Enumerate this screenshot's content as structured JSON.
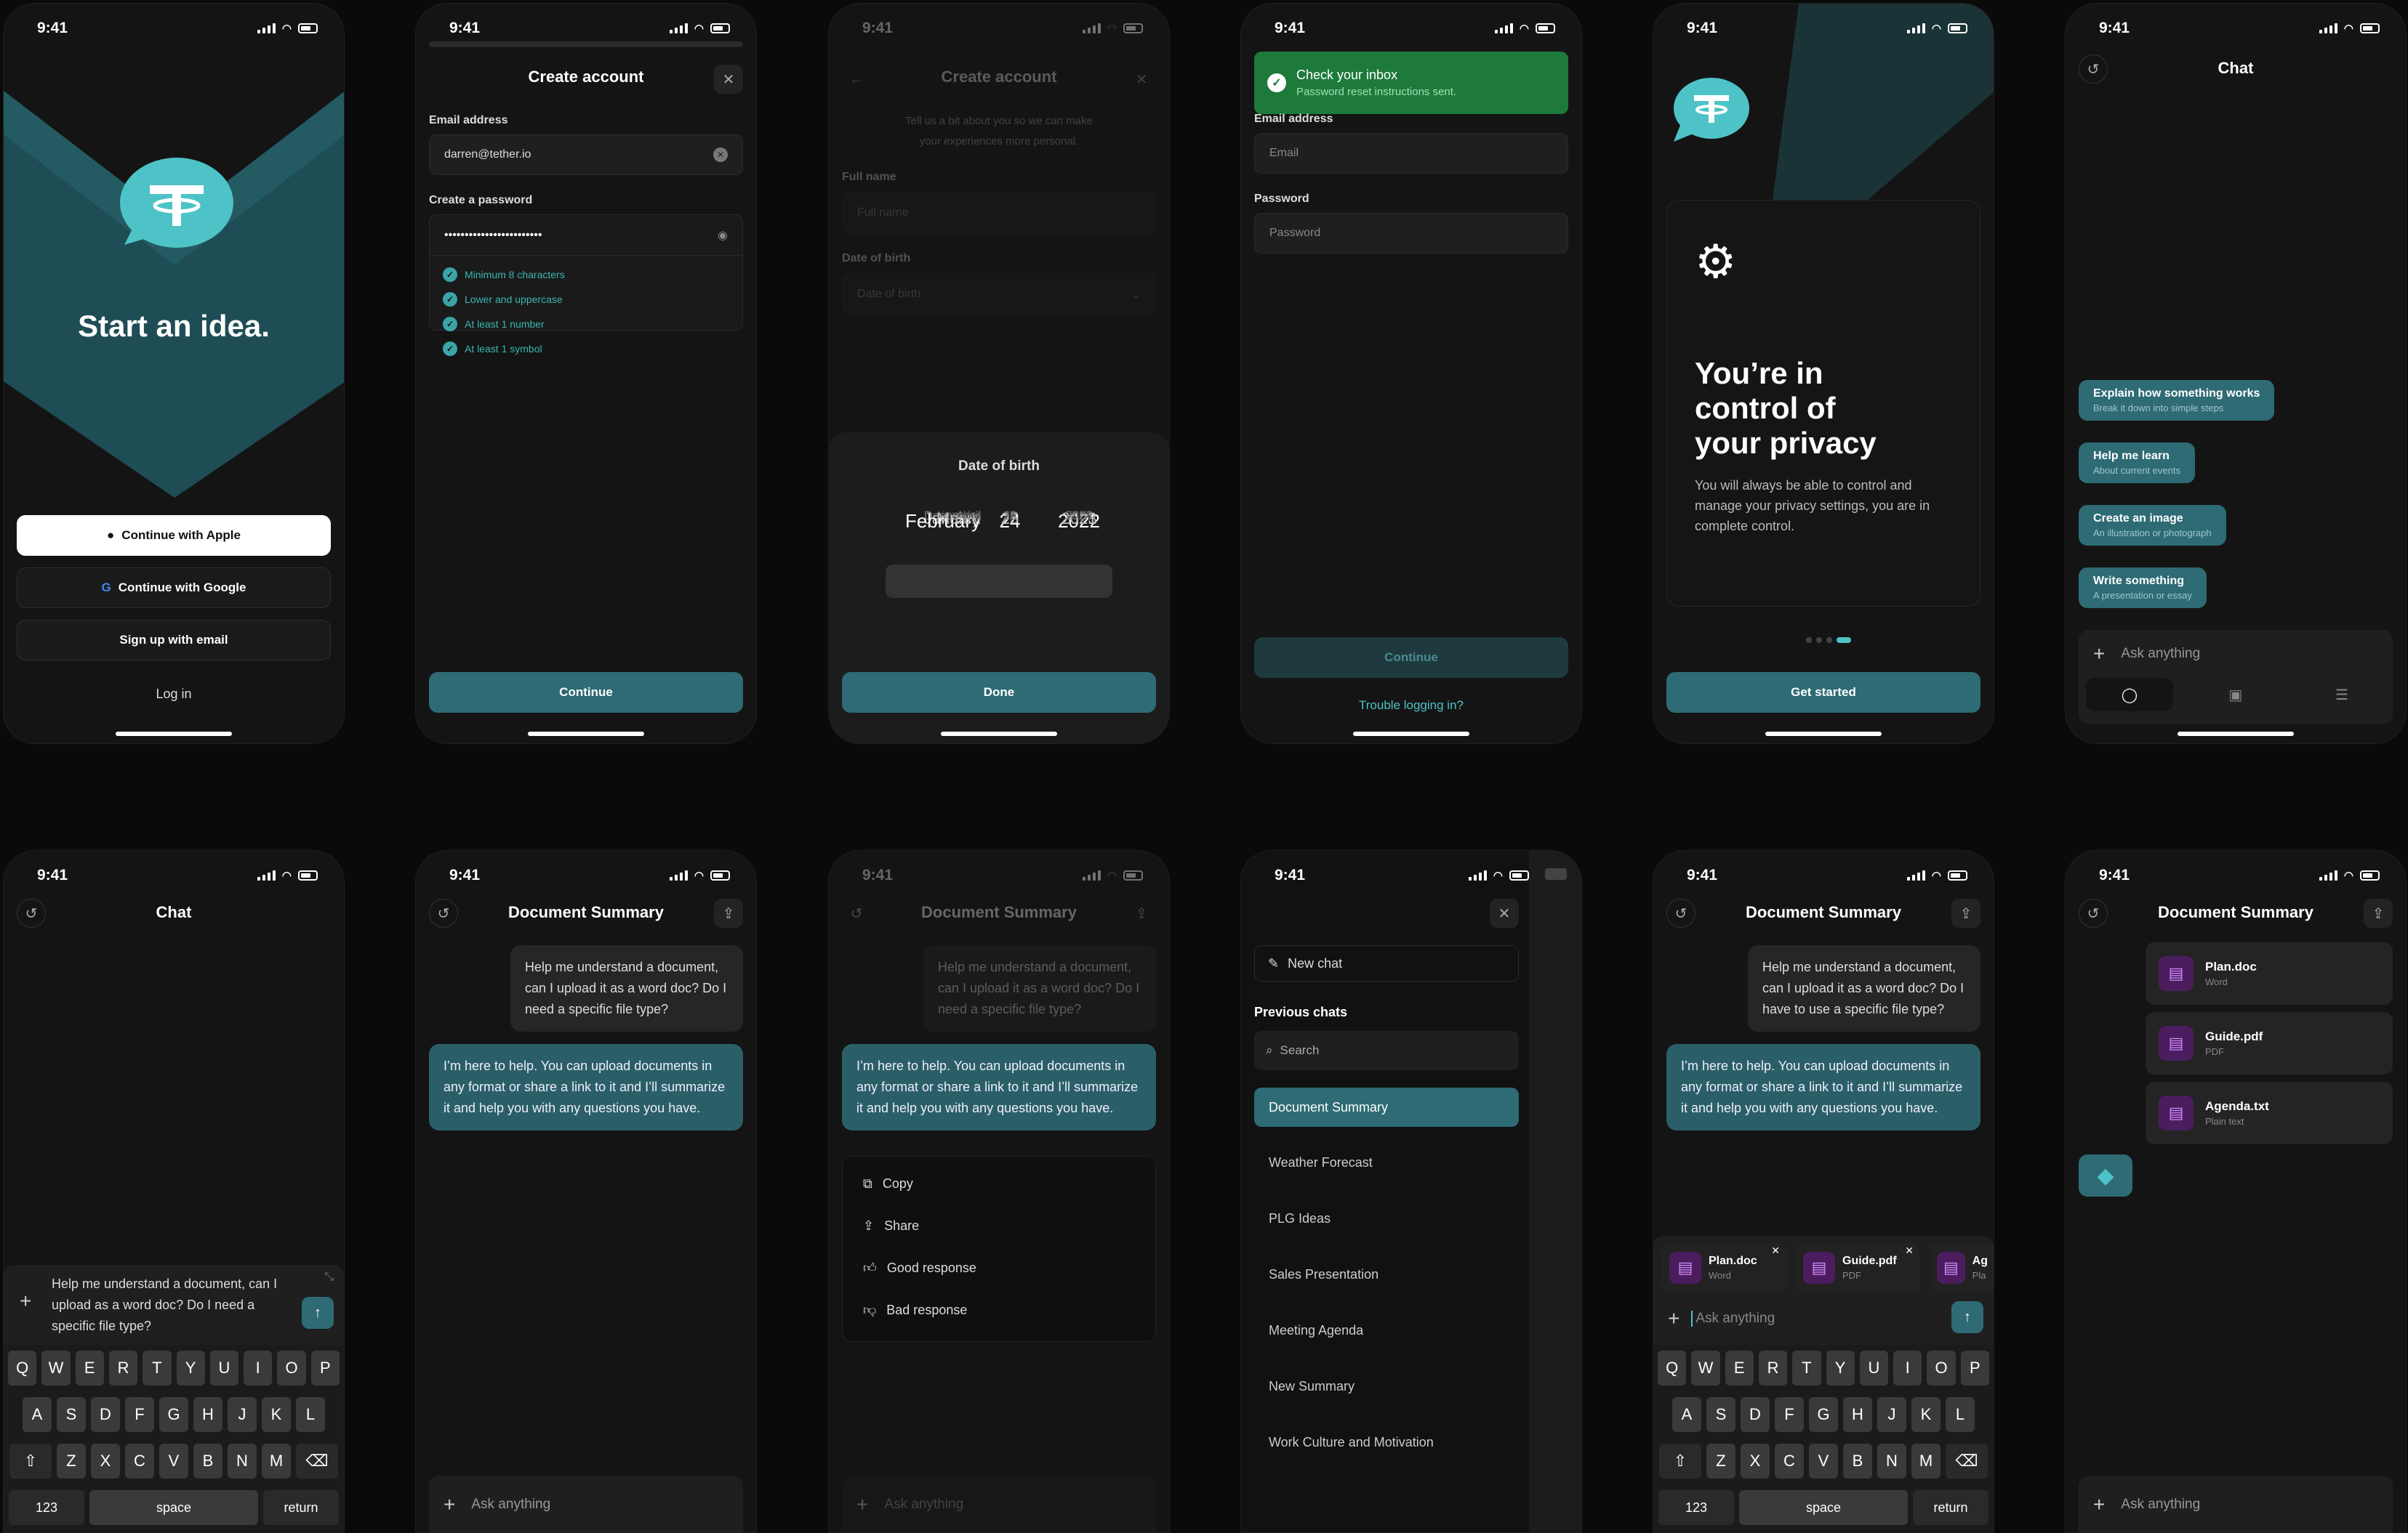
{
  "status_time": "9:41",
  "s1": {
    "headline": "Start an idea.",
    "apple": "Continue with Apple",
    "google": "Continue with Google",
    "email": "Sign up with email",
    "login": "Log in"
  },
  "s2": {
    "title": "Create account",
    "email_label": "Email address",
    "email_value": "darren@tether.io",
    "pw_label": "Create a password",
    "pw_value": "••••••••••••••••••••••••",
    "rules": [
      "Minimum 8 characters",
      "Lower and uppercase",
      "At least 1 number",
      "At least 1 symbol"
    ],
    "continue": "Continue"
  },
  "s3": {
    "title": "Create account",
    "subtitle1": "Tell us a bit about you so we can make",
    "subtitle2": "your experiences more personal.",
    "name_label": "Full name",
    "name_ph": "Full name",
    "dob_label": "Date of birth",
    "dob_ph": "Date of birth",
    "sheet_title": "Date of birth",
    "months": [
      "November",
      "December",
      "January",
      "February",
      "March",
      "April",
      "May"
    ],
    "days": [
      "21",
      "22",
      "23",
      "24",
      "25",
      "26",
      "27"
    ],
    "years": [
      "2019",
      "2020",
      "2021",
      "2022",
      "2023",
      "2024",
      "2025"
    ],
    "done": "Done"
  },
  "s4": {
    "toast_title": "Check your inbox",
    "toast_sub": "Password reset instructions sent.",
    "email_label": "Email address",
    "email_ph": "Email",
    "pw_label": "Password",
    "pw_ph": "Password",
    "continue": "Continue",
    "trouble": "Trouble logging in?"
  },
  "s5": {
    "h1": "You’re in",
    "h2": "control of",
    "h3": "your privacy",
    "body": "You will always be able to control and manage your privacy settings, you are in complete control.",
    "cta": "Get started"
  },
  "s6": {
    "title": "Chat",
    "chips": [
      {
        "t": "Explain how something works",
        "s": "Break it down into simple steps"
      },
      {
        "t": "Help me learn",
        "s": "About current events"
      },
      {
        "t": "Create an image",
        "s": "An illustration or photograph"
      },
      {
        "t": "Write something",
        "s": "A presentation or essay"
      }
    ],
    "ask": "Ask anything"
  },
  "s7": {
    "title": "Chat",
    "input": "Help me understand a document, can I upload as a word doc? Do I need a specific file type?"
  },
  "keyboard": {
    "row1": [
      "Q",
      "W",
      "E",
      "R",
      "T",
      "Y",
      "U",
      "I",
      "O",
      "P"
    ],
    "row2": [
      "A",
      "S",
      "D",
      "F",
      "G",
      "H",
      "J",
      "K",
      "L"
    ],
    "row3": [
      "Z",
      "X",
      "C",
      "V",
      "B",
      "N",
      "M"
    ],
    "num": "123",
    "space": "space",
    "ret": "return"
  },
  "s8": {
    "title": "Document Summary",
    "user": "Help me understand a document, can I upload it as a word doc? Do I need a specific file type?",
    "ai": "I’m here to help. You can upload documents in any format or share a link to it and I’ll summarize it and help you with any questions you have.",
    "ask": "Ask anything"
  },
  "s9": {
    "title": "Document Summary",
    "menu": [
      "Copy",
      "Share",
      "Good response",
      "Bad response"
    ],
    "ask": "Ask anything"
  },
  "s10": {
    "new_chat": "New chat",
    "prev": "Previous chats",
    "search": "Search",
    "items": [
      "Document Summary",
      "Weather Forecast",
      "PLG Ideas",
      "Sales Presentation",
      "Meeting Agenda",
      "New Summary",
      "Work Culture and Motivation"
    ]
  },
  "s11": {
    "title": "Document Summary",
    "user": "Help me understand a document, can I upload it as a word doc? Do I have to use a specific file type?",
    "files": [
      {
        "n": "Plan.doc",
        "t": "Word"
      },
      {
        "n": "Guide.pdf",
        "t": "PDF"
      },
      {
        "n": "Ag",
        "t": "Pla"
      }
    ],
    "ask": "Ask anything"
  },
  "s12": {
    "title": "Document Summary",
    "files": [
      {
        "n": "Plan.doc",
        "t": "Word"
      },
      {
        "n": "Guide.pdf",
        "t": "PDF"
      },
      {
        "n": "Agenda.txt",
        "t": "Plain text"
      }
    ],
    "ask": "Ask anything"
  },
  "colors": {
    "teal": "#2e6b74",
    "toast": "#1d7a3b",
    "file_icon": "#4b1d5e"
  }
}
